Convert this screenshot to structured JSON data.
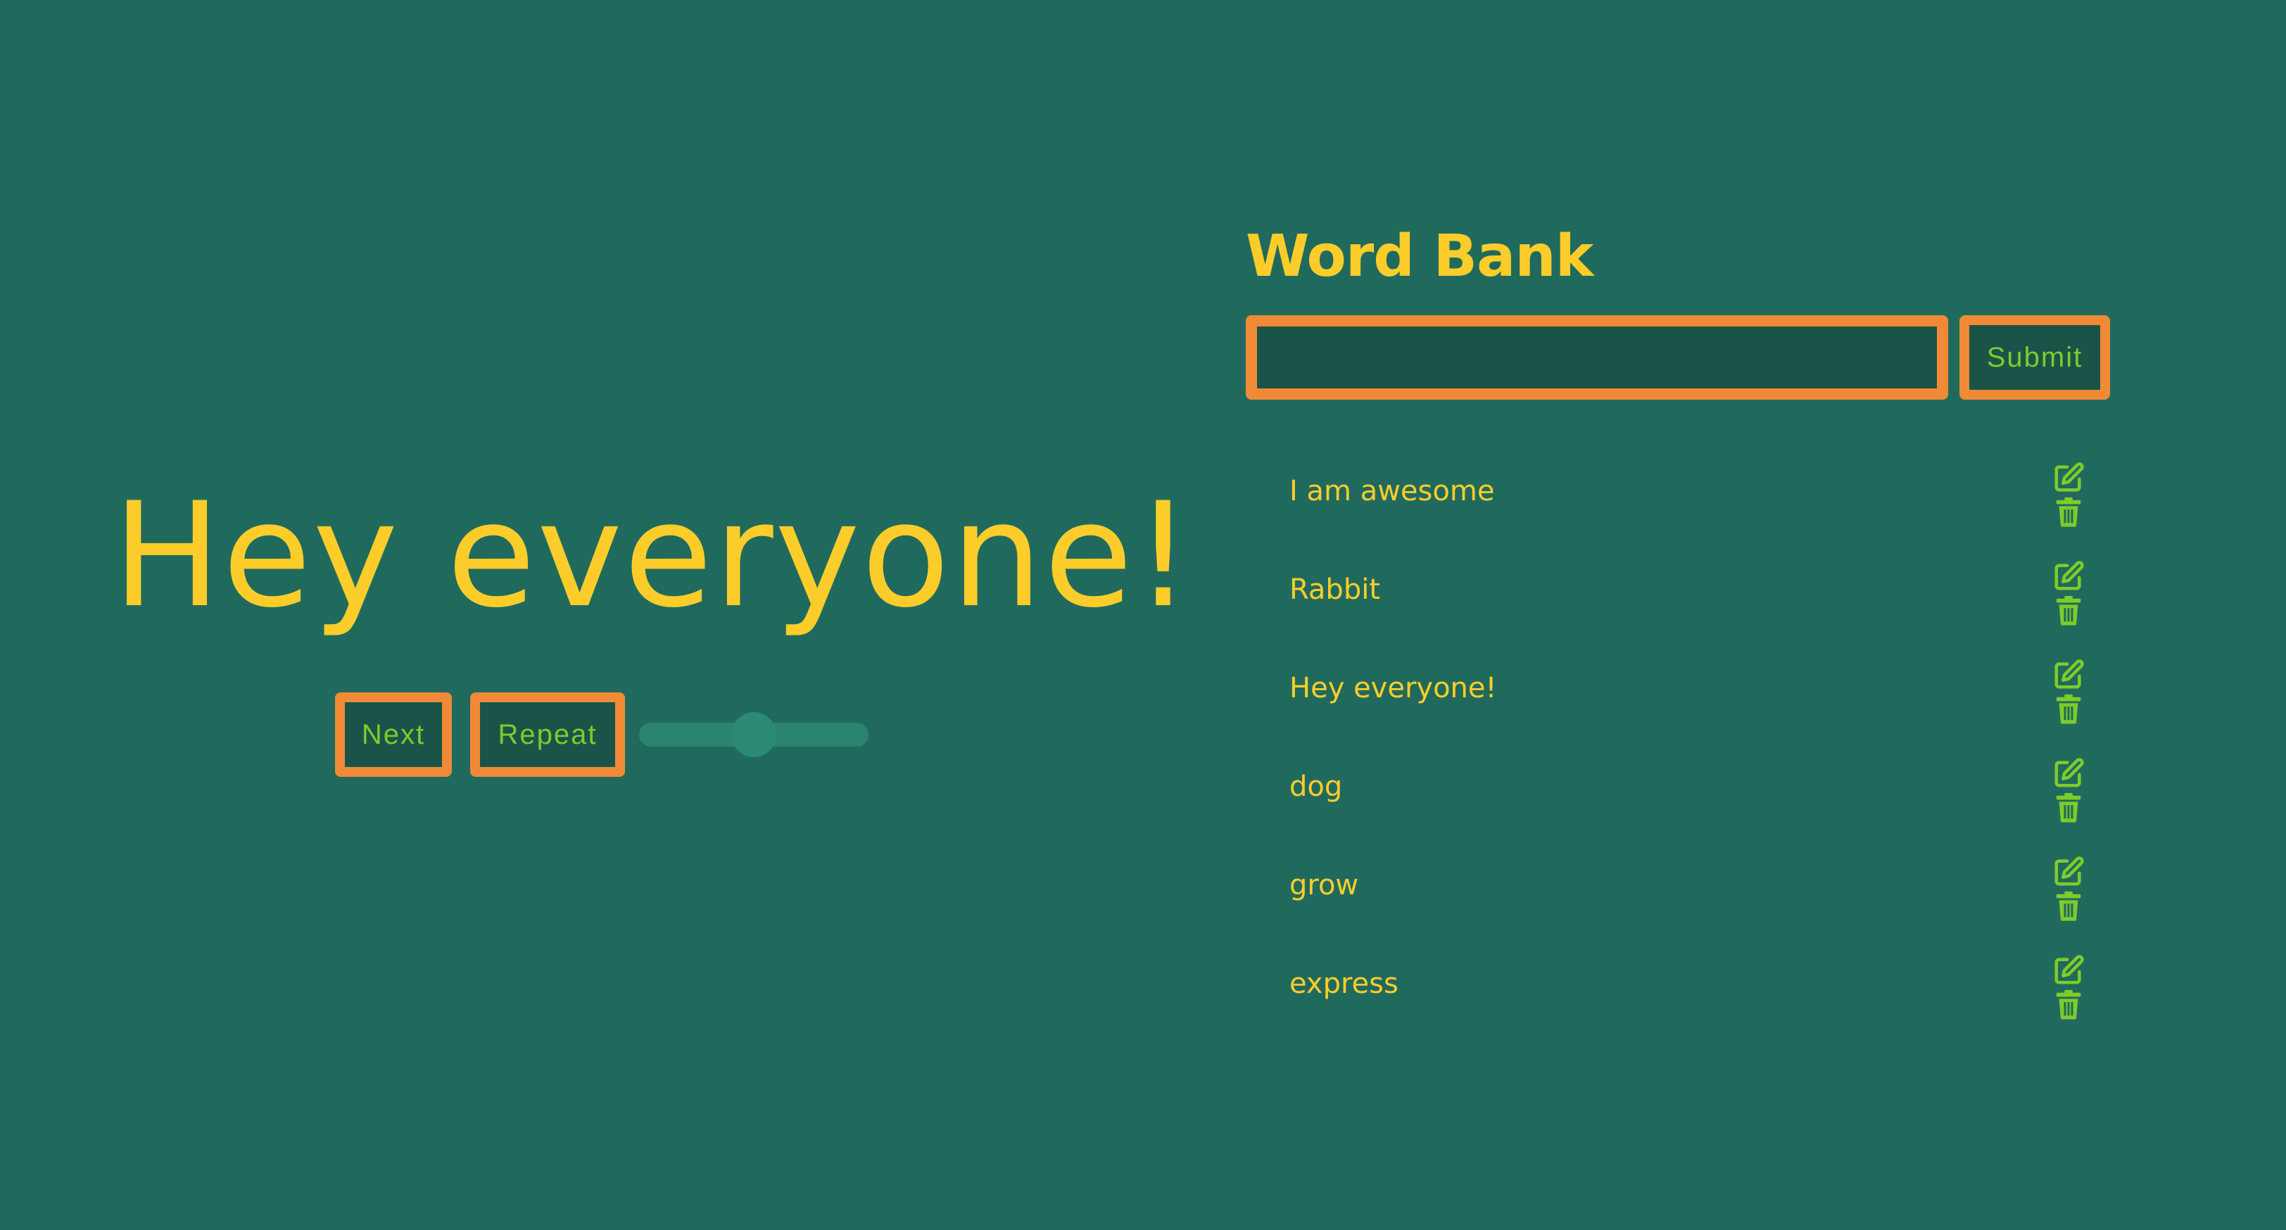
{
  "colors": {
    "background": "#206a5d",
    "text_primary": "#fccd2a",
    "button_bg": "#1a5449",
    "button_border": "#f08a36",
    "button_text": "#7ecb2b",
    "slider_track": "#2b8470",
    "slider_thumb": "#2a8a74",
    "icon": "#7ecb2b"
  },
  "display": {
    "current_word": "Hey everyone!"
  },
  "controls": {
    "next_label": "Next",
    "repeat_label": "Repeat",
    "speed_slider_value": 0.5
  },
  "word_bank": {
    "title": "Word Bank",
    "input_value": "",
    "submit_label": "Submit",
    "words": [
      {
        "text": "I am awesome",
        "edit_icon": "edit-icon",
        "delete_icon": "trash-icon"
      },
      {
        "text": "Rabbit",
        "edit_icon": "edit-icon",
        "delete_icon": "trash-icon"
      },
      {
        "text": "Hey everyone!",
        "edit_icon": "edit-icon",
        "delete_icon": "trash-icon"
      },
      {
        "text": "dog",
        "edit_icon": "edit-icon",
        "delete_icon": "trash-icon"
      },
      {
        "text": "grow",
        "edit_icon": "edit-icon",
        "delete_icon": "trash-icon"
      },
      {
        "text": "express",
        "edit_icon": "edit-icon",
        "delete_icon": "trash-icon"
      }
    ]
  }
}
